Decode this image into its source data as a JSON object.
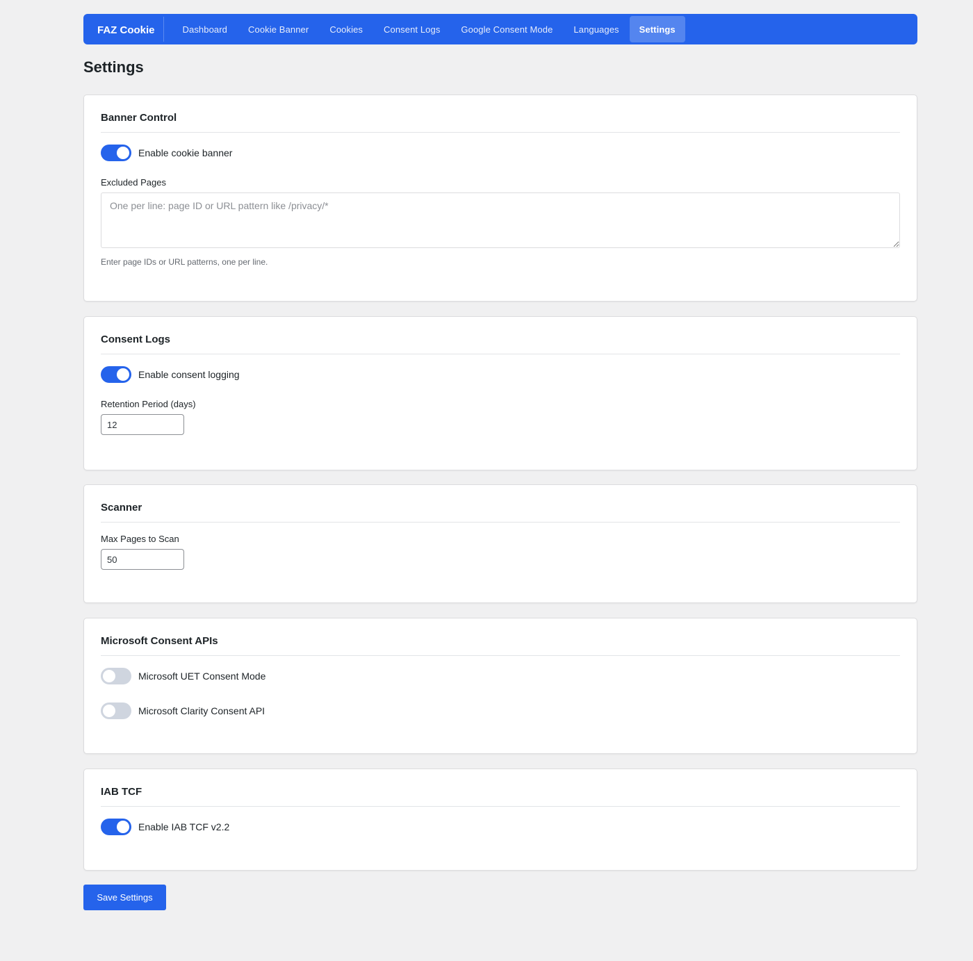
{
  "nav": {
    "brand": "FAZ Cookie",
    "items": [
      {
        "label": "Dashboard"
      },
      {
        "label": "Cookie Banner"
      },
      {
        "label": "Cookies"
      },
      {
        "label": "Consent Logs"
      },
      {
        "label": "Google Consent Mode"
      },
      {
        "label": "Languages"
      },
      {
        "label": "Settings",
        "active": true
      }
    ]
  },
  "page": {
    "title": "Settings"
  },
  "banner_control": {
    "title": "Banner Control",
    "enable_label": "Enable cookie banner",
    "enabled": true,
    "excluded_label": "Excluded Pages",
    "excluded_placeholder": "One per line: page ID or URL pattern like /privacy/*",
    "excluded_help": "Enter page IDs or URL patterns, one per line."
  },
  "consent_logs": {
    "title": "Consent Logs",
    "enable_label": "Enable consent logging",
    "enabled": true,
    "retention_label": "Retention Period (days)",
    "retention_value": "12"
  },
  "scanner": {
    "title": "Scanner",
    "max_pages_label": "Max Pages to Scan",
    "max_pages_value": "50"
  },
  "microsoft": {
    "title": "Microsoft Consent APIs",
    "uet_label": "Microsoft UET Consent Mode",
    "uet_enabled": false,
    "clarity_label": "Microsoft Clarity Consent API",
    "clarity_enabled": false
  },
  "iab": {
    "title": "IAB TCF",
    "enable_label": "Enable IAB TCF v2.2",
    "enabled": true
  },
  "actions": {
    "save_label": "Save Settings"
  },
  "colors": {
    "accent": "#2563eb",
    "toggle_off": "#cfd5df",
    "background": "#f0f0f1"
  }
}
